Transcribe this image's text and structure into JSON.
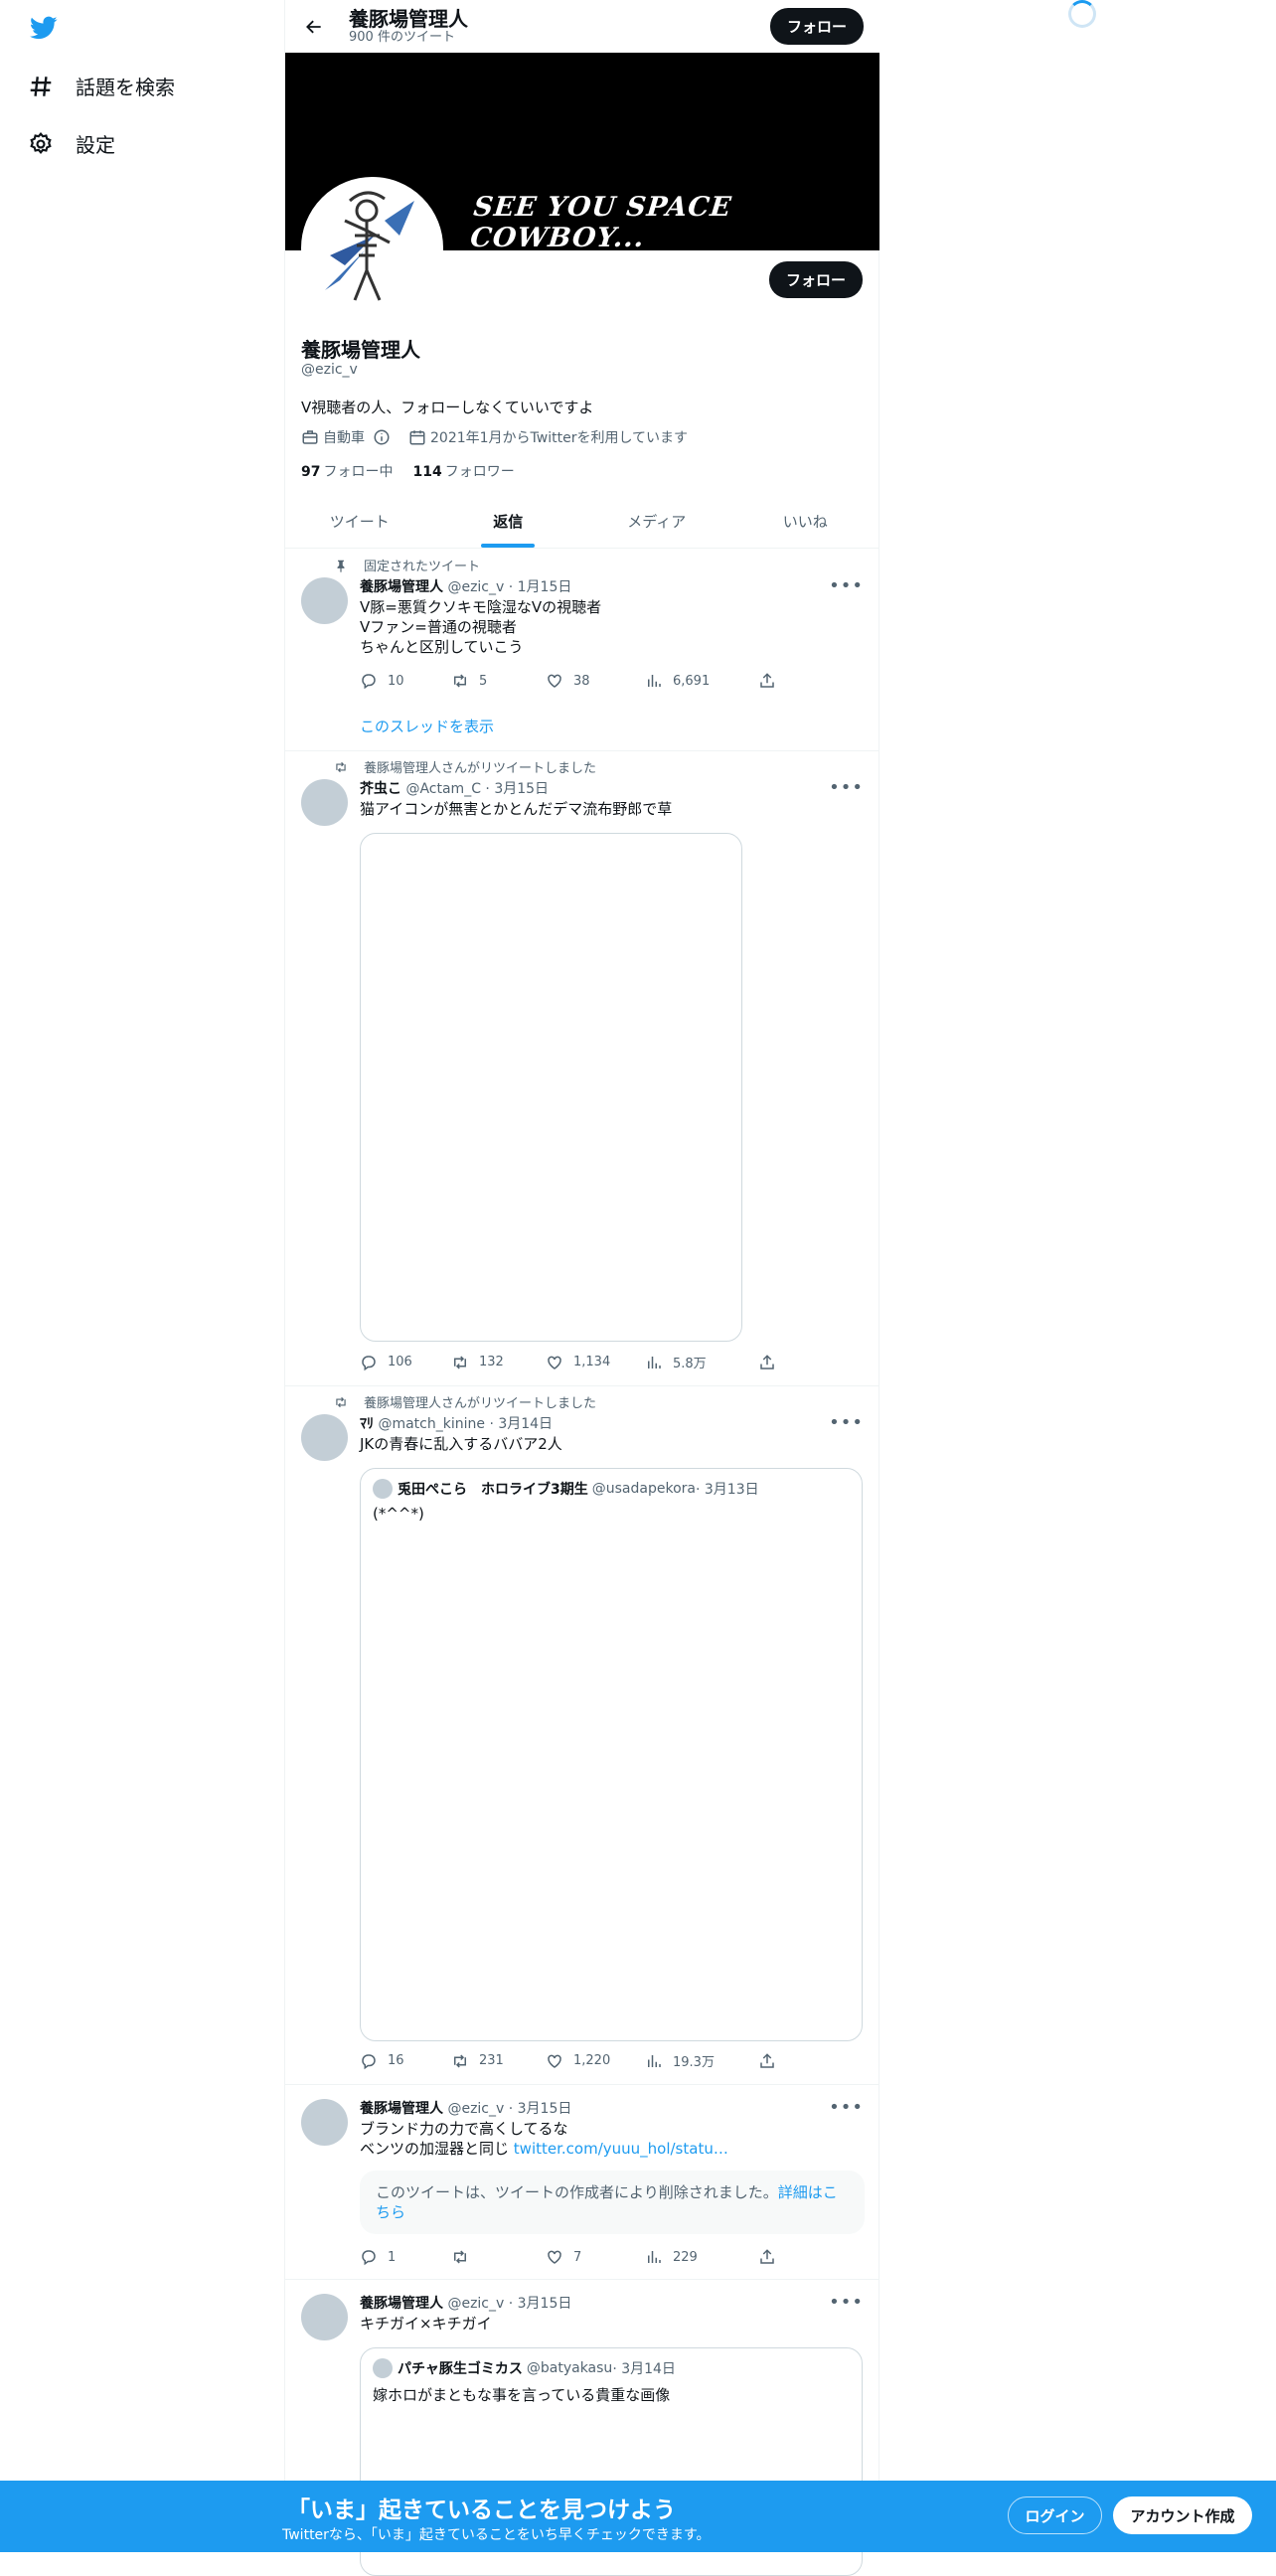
{
  "nav": {
    "logo": "twitter-bird-icon",
    "explore_label": "話題を検索",
    "settings_label": "設定"
  },
  "header": {
    "name": "養豚場管理人",
    "tweet_count": "900 件のツイート",
    "follow_label": "フォロー"
  },
  "banner": {
    "text": "SEE YOU SPACE COWBOY..."
  },
  "profile": {
    "name": "養豚場管理人",
    "handle": "@ezic_v",
    "bio": "V視聴者の人、フォローしなくていいですよ",
    "category": "自動車",
    "joined": "2021年1月からTwitterを利用しています",
    "following_count": "97",
    "following_label": "フォロー中",
    "followers_count": "114",
    "followers_label": "フォロワー",
    "follow_label": "フォロー"
  },
  "tabs": [
    {
      "label": "ツイート",
      "active": false
    },
    {
      "label": "返信",
      "active": true
    },
    {
      "label": "メディア",
      "active": false
    },
    {
      "label": "いいね",
      "active": false
    }
  ],
  "tweets": [
    {
      "context": "固定されたツイート",
      "name": "養豚場管理人",
      "handle": "@ezic_v",
      "date": "· 1月15日",
      "lines": [
        "V豚=悪質クソキモ陰湿なVの視聴者",
        "Vファン=普通の視聴者",
        "ちゃんと区別していこう"
      ],
      "replies": "10",
      "retweets": "5",
      "likes": "38",
      "views": "6,691",
      "thread_link": "このスレッドを表示"
    },
    {
      "context": "養豚場管理人さんがリツイートしました",
      "name": "芥虫こ",
      "handle": "@Actam_C",
      "date": "· 3月15日",
      "lines": [
        "猫アイコンが無害とかとんだデマ流布野郎で草"
      ],
      "replies": "106",
      "retweets": "132",
      "likes": "1,134",
      "views": "5.8万"
    },
    {
      "context": "養豚場管理人さんがリツイートしました",
      "name": "ﾏﾘ",
      "handle": "@match_kinine",
      "date": "· 3月14日",
      "lines": [
        "JKの青春に乱入するババア2人"
      ],
      "quote": {
        "name": "兎田ぺこら　ホロライブ3期生",
        "handle": "@usadapekora",
        "date": "· 3月13日",
        "text": "(*^^*)"
      },
      "replies": "16",
      "retweets": "231",
      "likes": "1,220",
      "views": "19.3万"
    },
    {
      "name": "養豚場管理人",
      "handle": "@ezic_v",
      "date": "· 3月15日",
      "lines": [
        "ブランド力の力で高くしてるな"
      ],
      "line2_prefix": "ベンツの加湿器と同じ",
      "line2_link": "twitter.com/yuuu_hol/statu…",
      "deleted_text": "このツイートは、ツイートの作成者により削除されました。",
      "deleted_link": "詳細はこちら",
      "replies": "1",
      "retweets": "",
      "likes": "7",
      "views": "229"
    },
    {
      "name": "養豚場管理人",
      "handle": "@ezic_v",
      "date": "· 3月15日",
      "lines": [
        "キチガイ×キチガイ"
      ],
      "quote": {
        "name": "パチャ豚生ゴミカス",
        "handle": "@batyakasu",
        "date": "· 3月14日",
        "text": "嫁ホロがまともな事を言っている貴重な画像"
      }
    }
  ],
  "bottom_bar": {
    "title": "「いま」起きていることを見つけよう",
    "subtitle": "Twitterなら、「いま」起きていることをいち早くチェックできます。",
    "login_label": "ログイン",
    "signup_label": "アカウント作成"
  },
  "colors": {
    "accent": "#1d9bf0",
    "text": "#0f1419",
    "muted": "#536471"
  }
}
